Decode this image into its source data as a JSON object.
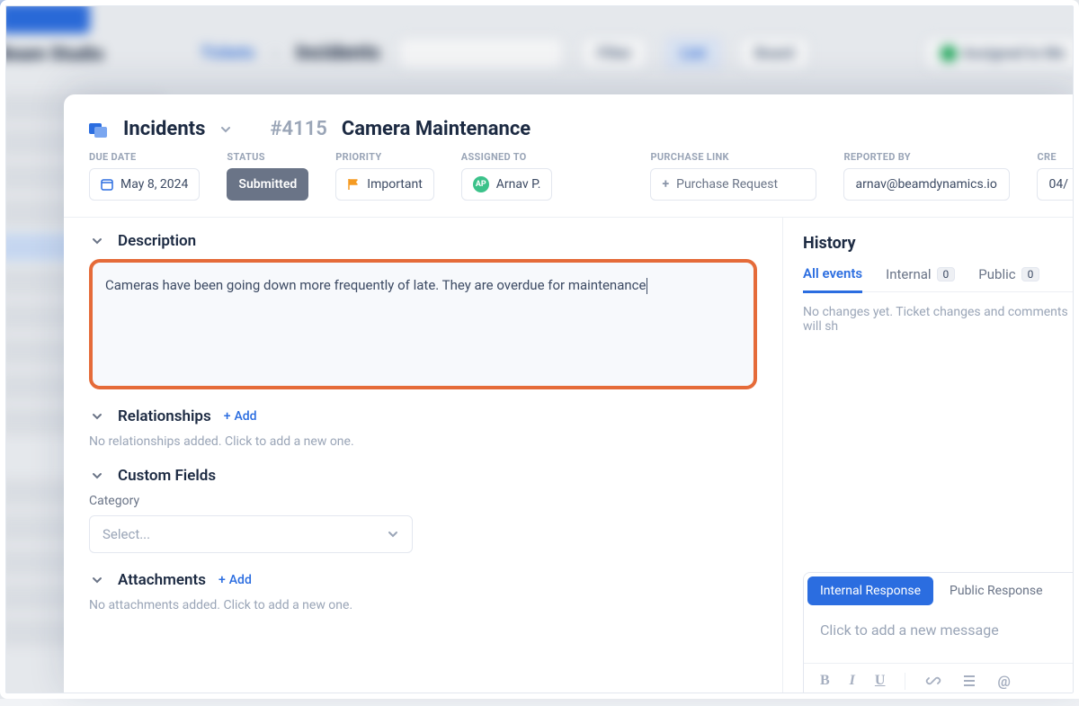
{
  "breadcrumb": {
    "category": "Incidents",
    "ticket_id": "#4115",
    "ticket_title": "Camera Maintenance"
  },
  "meta": {
    "due_date": {
      "label": "DUE DATE",
      "value": "May 8, 2024"
    },
    "status": {
      "label": "STATUS",
      "value": "Submitted"
    },
    "priority": {
      "label": "PRIORITY",
      "value": "Important"
    },
    "assigned_to": {
      "label": "ASSIGNED TO",
      "value": "Arnav P.",
      "initials": "AP"
    },
    "purchase_link": {
      "label": "PURCHASE LINK",
      "value": "Purchase Request"
    },
    "reported_by": {
      "label": "REPORTED BY",
      "value": "arnav@beamdynamics.io"
    },
    "created": {
      "label": "CRE",
      "value": "04/"
    }
  },
  "sections": {
    "description": {
      "title": "Description",
      "text": "Cameras have been going down more frequently of late. They are overdue for maintenance"
    },
    "relationships": {
      "title": "Relationships",
      "add_label": "Add",
      "helper": "No relationships added. Click to add a new one."
    },
    "custom_fields": {
      "title": "Custom Fields",
      "category_label": "Category",
      "select_placeholder": "Select..."
    },
    "attachments": {
      "title": "Attachments",
      "add_label": "Add",
      "helper": "No attachments added. Click to add a new one."
    }
  },
  "history": {
    "title": "History",
    "tabs": {
      "all": "All events",
      "internal": "Internal",
      "internal_count": "0",
      "public": "Public",
      "public_count": "0"
    },
    "empty": "No changes yet. Ticket changes and comments will sh"
  },
  "composer": {
    "internal_tab": "Internal Response",
    "public_tab": "Public Response",
    "placeholder": "Click to add a new message"
  },
  "bg": {
    "brand": "Beam Studio",
    "crumb1": "Tickets",
    "crumb2": "Incidents",
    "filter": "Filter",
    "list": "List",
    "board": "Board",
    "assigned": "Assigned to Me"
  }
}
